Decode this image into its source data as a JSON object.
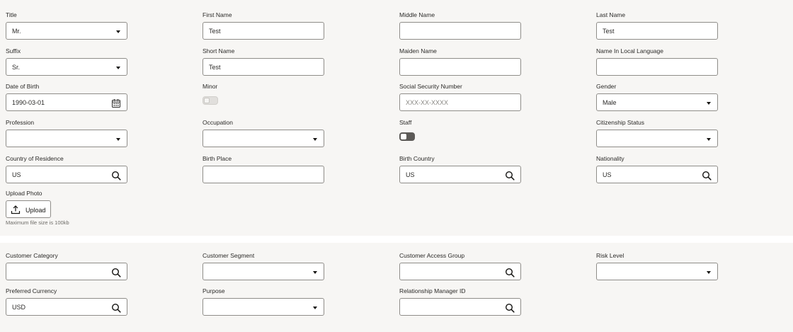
{
  "personal": {
    "title": {
      "label": "Title",
      "value": "Mr."
    },
    "first_name": {
      "label": "First Name",
      "value": "Test"
    },
    "middle_name": {
      "label": "Middle Name",
      "value": ""
    },
    "last_name": {
      "label": "Last Name",
      "value": "Test"
    },
    "suffix": {
      "label": "Suffix",
      "value": "Sr."
    },
    "short_name": {
      "label": "Short Name",
      "value": "Test"
    },
    "maiden_name": {
      "label": "Maiden Name",
      "value": ""
    },
    "local_name": {
      "label": "Name In Local Language",
      "value": ""
    },
    "dob": {
      "label": "Date of Birth",
      "value": "1990-03-01"
    },
    "minor": {
      "label": "Minor",
      "state": "off"
    },
    "ssn": {
      "label": "Social Security Number",
      "placeholder": "XXX-XX-XXXX"
    },
    "gender": {
      "label": "Gender",
      "value": "Male"
    },
    "profession": {
      "label": "Profession",
      "value": ""
    },
    "occupation": {
      "label": "Occupation",
      "value": ""
    },
    "staff": {
      "label": "Staff",
      "state": "off"
    },
    "citizenship": {
      "label": "Citizenship Status",
      "value": ""
    },
    "country_residence": {
      "label": "Country of Residence",
      "value": "US"
    },
    "birth_place": {
      "label": "Birth Place",
      "value": ""
    },
    "birth_country": {
      "label": "Birth Country",
      "value": "US"
    },
    "nationality": {
      "label": "Nationality",
      "value": "US"
    },
    "upload": {
      "label": "Upload Photo",
      "button": "Upload",
      "hint": "Maximum file size is 100kb"
    }
  },
  "customer": {
    "category": {
      "label": "Customer Category",
      "value": ""
    },
    "segment": {
      "label": "Customer Segment",
      "value": ""
    },
    "access_group": {
      "label": "Customer Access Group",
      "value": ""
    },
    "risk_level": {
      "label": "Risk Level",
      "value": ""
    },
    "currency": {
      "label": "Preferred Currency",
      "value": "USD"
    },
    "purpose": {
      "label": "Purpose",
      "value": ""
    },
    "rm_id": {
      "label": "Relationship Manager ID",
      "value": ""
    }
  },
  "icons": {
    "search": "search-icon",
    "calendar": "calendar-icon",
    "dropdown": "chevron-down-icon",
    "upload": "upload-icon"
  },
  "colors": {
    "panel_bg": "#f7f6f4",
    "border": "#8f8d89",
    "toggle_staff": "#5c5a57"
  }
}
